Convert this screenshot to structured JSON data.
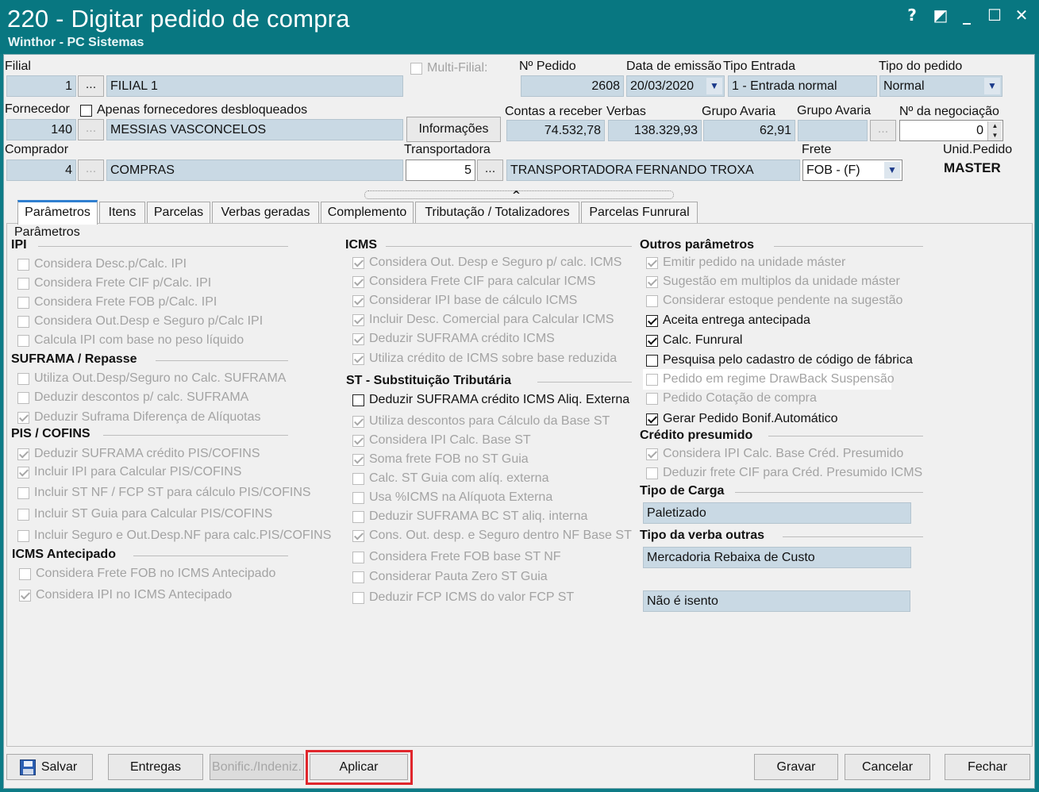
{
  "window": {
    "title": "220 - Digitar pedido de compra",
    "subtitle": "Winthor - PC Sistemas",
    "controls": [
      "?",
      "◩",
      "_",
      "☐",
      "✕"
    ]
  },
  "header": {
    "filial_label": "Filial",
    "filial_code": "1",
    "filial_name": "FILIAL 1",
    "multifilial_label": "Multi-Filial:",
    "npedido_label": "Nº Pedido",
    "npedido_value": "2608",
    "data_emissao_label": "Data de emissão",
    "data_emissao_value": "20/03/2020",
    "tipo_entrada_label": "Tipo Entrada",
    "tipo_entrada_value": "1 - Entrada normal",
    "tipo_pedido_label": "Tipo do pedido",
    "tipo_pedido_value": "Normal",
    "fornecedor_label": "Fornecedor",
    "apenas_desbloq_label": "Apenas fornecedores desbloqueados",
    "fornecedor_code": "140",
    "fornecedor_name": "MESSIAS VASCONCELOS",
    "informacoes_button": "Informações",
    "contas_receber_label": "Contas a receber",
    "contas_receber_value": "74.532,78",
    "verbas_label": "Verbas",
    "verbas_value": "138.329,93",
    "grupo_avaria_label": "Grupo Avaria",
    "grupo_avaria_value": "62,91",
    "grupo_avaria2_label": "Grupo Avaria",
    "grupo_avaria2_value": "",
    "negociacao_label": "Nº da negociação",
    "negociacao_value": "0",
    "comprador_label": "Comprador",
    "comprador_code": "4",
    "comprador_name": "COMPRAS",
    "transportadora_label": "Transportadora",
    "transportadora_code": "5",
    "transportadora_name": "TRANSPORTADORA FERNANDO TROXA",
    "frete_label": "Frete",
    "frete_value": "FOB - (F)",
    "unid_pedido_label": "Unid.Pedido",
    "unid_pedido_value": "MASTER",
    "dots": "...",
    "collapse_arrow": "^"
  },
  "tabs": [
    "Parâmetros",
    "Itens",
    "Parcelas",
    "Verbas geradas",
    "Complemento",
    "Tributação / Totalizadores",
    "Parcelas Funrural"
  ],
  "params": {
    "group_label": "Parâmetros",
    "ipi": {
      "title": "IPI",
      "items": [
        "Considera Desc.p/Calc. IPI",
        "Considera Frete CIF p/Calc. IPI",
        "Considera Frete FOB p/Calc. IPI",
        "Considera Out.Desp e Seguro p/Calc IPI",
        "Calcula IPI com base no peso líquido"
      ]
    },
    "suframa": {
      "title": "SUFRAMA / Repasse",
      "items": [
        "Utiliza Out.Desp/Seguro no Calc. SUFRAMA",
        "Deduzir descontos p/ calc. SUFRAMA",
        "Deduzir Suframa Diferença de Alíquotas"
      ]
    },
    "pis": {
      "title": "PIS / COFINS",
      "items": [
        "Deduzir SUFRAMA crédito PIS/COFINS",
        "Incluir IPI para Calcular PIS/COFINS",
        "Incluir ST NF / FCP ST para cálculo PIS/COFINS",
        "Incluir ST Guia para Calcular PIS/COFINS",
        "Incluir Seguro e Out.Desp.NF para calc.PIS/COFINS"
      ]
    },
    "icms_ant": {
      "title": "ICMS Antecipado",
      "items": [
        "Considera Frete FOB no ICMS Antecipado",
        "Considera IPI no ICMS Antecipado"
      ]
    },
    "icms": {
      "title": "ICMS",
      "items": [
        "Considera Out. Desp e Seguro p/ calc. ICMS",
        "Considera Frete CIF para calcular ICMS",
        "Considerar IPI base de cálculo ICMS",
        "Incluir Desc. Comercial  para Calcular ICMS",
        "Deduzir SUFRAMA crédito ICMS",
        "Utiliza crédito de ICMS sobre base reduzida"
      ]
    },
    "st": {
      "title": "ST - Substituição Tributária",
      "items": [
        "Deduzir SUFRAMA crédito ICMS Aliq. Externa",
        "Utiliza descontos para Cálculo da Base ST",
        "Considera IPI Calc. Base ST",
        "Soma frete FOB no ST Guia",
        "Calc. ST Guia com alíq. externa",
        "Usa %ICMS na Alíquota Externa",
        "Deduzir SUFRAMA BC ST aliq. interna",
        "Cons. Out. desp. e Seguro dentro NF Base ST",
        "Considera Frete FOB base ST NF",
        "Considerar Pauta Zero ST Guia",
        "Deduzir FCP ICMS do valor FCP ST"
      ]
    },
    "outros": {
      "title": "Outros parâmetros",
      "items": [
        "Emitir pedido na unidade máster",
        "Sugestão em multiplos da unidade máster",
        "Considerar estoque pendente na sugestão",
        "Aceita entrega antecipada",
        "Calc. Funrural",
        "Pesquisa pelo cadastro de código de fábrica",
        "Pedido em regime DrawBack Suspensão",
        "Pedido Cotação de compra",
        "Gerar Pedido Bonif.Automático"
      ]
    },
    "credito": {
      "title": "Crédito presumido",
      "items": [
        "Considera IPI Calc. Base Créd. Presumido",
        "Deduzir frete CIF para Créd. Presumido ICMS"
      ]
    },
    "tipo_carga": {
      "title": "Tipo de Carga",
      "value": "Paletizado"
    },
    "tipo_verba": {
      "title": "Tipo da verba outras",
      "value": "Mercadoria Rebaixa de Custo"
    },
    "isento_value": "Não é isento"
  },
  "footer": {
    "salvar": "Salvar",
    "entregas": "Entregas",
    "bonific": "Bonific./Indeniz.",
    "aplicar": "Aplicar",
    "gravar": "Gravar",
    "cancelar": "Cancelar",
    "fechar": "Fechar"
  },
  "colors": {
    "title_bg": "#087781",
    "field_bg": "#c9d9e4",
    "highlight": "#e0262c",
    "tab_accent": "#2f7fd0"
  }
}
